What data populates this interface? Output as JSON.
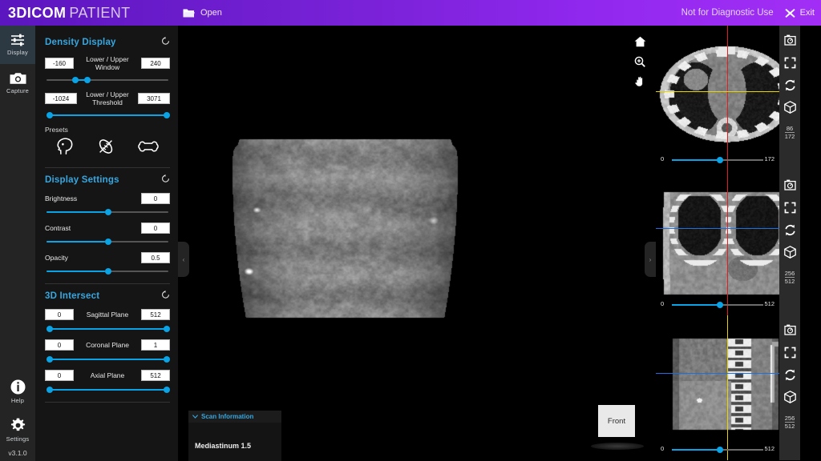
{
  "app": {
    "brand_primary": "3DICOM",
    "brand_secondary": "PATIENT",
    "version": "v3.1.0",
    "accent_blue": "#36a7e0",
    "slider_blue": "#0aa3e6",
    "brand_purple": "#7a22d8"
  },
  "topbar": {
    "open_label": "Open",
    "disclaimer": "Not for Diagnostic Use",
    "exit_label": "Exit"
  },
  "rail": {
    "items": [
      {
        "label": "Display",
        "icon": "sliders-icon",
        "active": true
      },
      {
        "label": "Capture",
        "icon": "camera-icon",
        "active": false
      }
    ],
    "bottom_items": [
      {
        "label": "Help",
        "icon": "info-icon"
      },
      {
        "label": "Settings",
        "icon": "gear-icon"
      }
    ]
  },
  "density_display": {
    "title": "Density Display",
    "window": {
      "label_line1": "Lower / Upper",
      "label_line2": "Window",
      "lower": "-160",
      "upper": "240",
      "lower_pct": 22,
      "upper_pct": 32
    },
    "threshold": {
      "label_line1": "Lower / Upper",
      "label_line2": "Threshold",
      "lower": "-1024",
      "upper": "3071",
      "lower_pct": 0,
      "upper_pct": 100
    },
    "presets_label": "Presets",
    "presets": [
      {
        "name": "head-preset",
        "icon": "head-icon"
      },
      {
        "name": "lung-preset",
        "icon": "lung-icon"
      },
      {
        "name": "bone-preset",
        "icon": "bone-icon"
      }
    ]
  },
  "display_settings": {
    "title": "Display Settings",
    "rows": [
      {
        "label": "Brightness",
        "value": "0",
        "pct": 50
      },
      {
        "label": "Contrast",
        "value": "0",
        "pct": 50
      },
      {
        "label": "Opacity",
        "value": "0.5",
        "pct": 50
      }
    ]
  },
  "intersect": {
    "title": "3D Intersect",
    "rows": [
      {
        "label": "Sagittal Plane",
        "min": "0",
        "max": "512",
        "low_pct": 0,
        "high_pct": 100
      },
      {
        "label": "Coronal Plane",
        "min": "0",
        "max": "1",
        "low_pct": 0,
        "high_pct": 100
      },
      {
        "label": "Axial Plane",
        "min": "0",
        "max": "512",
        "low_pct": 0,
        "high_pct": 100
      }
    ]
  },
  "viewport": {
    "tools": [
      {
        "name": "home-icon",
        "label": "Home"
      },
      {
        "name": "zoom-in-icon",
        "label": "Zoom"
      },
      {
        "name": "pan-hand-icon",
        "label": "Pan"
      }
    ],
    "collapse_left": "‹",
    "collapse_right": "›",
    "orientation_label": "Front",
    "scan_info": {
      "title": "Scan Information",
      "series": "Mediastinum 1.5"
    }
  },
  "slices": [
    {
      "name": "axial-slice",
      "crosshair_v_color": "#e02020",
      "crosshair_h_color": "#e8d500",
      "slider": {
        "min": "0",
        "max": "172",
        "pct": 50
      },
      "fraction": {
        "current": "86",
        "total": "172"
      },
      "icons": [
        "capture-icon",
        "fullscreen-icon",
        "refresh-icon",
        "cube-icon"
      ]
    },
    {
      "name": "coronal-slice",
      "crosshair_v_color": "#e02020",
      "crosshair_h_color": "#1f6fe0",
      "slider": {
        "min": "0",
        "max": "512",
        "pct": 50
      },
      "fraction": {
        "current": "256",
        "total": "512"
      },
      "icons": [
        "capture-icon",
        "fullscreen-icon",
        "refresh-icon",
        "cube-icon"
      ]
    },
    {
      "name": "sagittal-slice",
      "crosshair_v_color": "#e8d500",
      "crosshair_h_color": "#1f6fe0",
      "slider": {
        "min": "0",
        "max": "512",
        "pct": 50
      },
      "fraction": {
        "current": "256",
        "total": "512"
      },
      "icons": [
        "capture-icon",
        "fullscreen-icon",
        "refresh-icon",
        "cube-icon"
      ]
    }
  ]
}
